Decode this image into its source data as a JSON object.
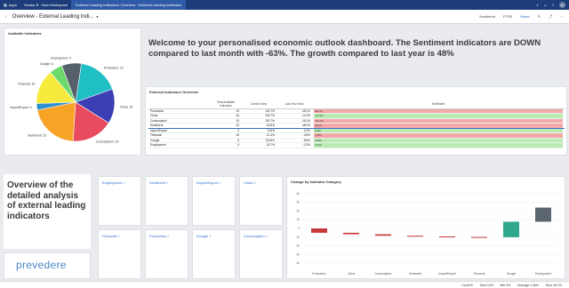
{
  "topbar": {
    "apps": "Apps",
    "workspace": "Vendor B · New Workspace",
    "tab": "External Leading Indicators: Overview · External Leading Indicators",
    "avatar": "ZH"
  },
  "sheet": {
    "title": "Overview - External Leading Indi...",
    "controls": [
      "Sentiment",
      "FTSE",
      "Reset"
    ]
  },
  "welcome": "Welcome to your personalised economic outlook dashboard. The Sentiment indicators are DOWN compared to last month with -63%. The growth compared to last year is 48%",
  "pie_panel": {
    "title": "Available Indicators"
  },
  "table_panel": {
    "title": "External Indicators Overview"
  },
  "table": {
    "headers": [
      "",
      "Total Available Indicators",
      "Current View",
      "Last Year View",
      "Sentiment"
    ],
    "rows": [
      {
        "name": "Production",
        "total": "19",
        "current": "100.7%",
        "last": "48.1%",
        "trend": "down"
      },
      {
        "name": "China",
        "total": "16",
        "current": "100.7%",
        "last": "-10.3%",
        "trend": "up"
      },
      {
        "name": "Consumption",
        "total": "19",
        "current": "100.7%",
        "last": "-16.1%",
        "trend": "down"
      },
      {
        "name": "Sentiment",
        "total": "23",
        "current": "-63.8%",
        "last": "48.0%",
        "trend": "down"
      },
      {
        "name": "Import/Export",
        "total": "3",
        "current": "74.8%",
        "last": "0.4%",
        "trend": "up"
      },
      {
        "name": "Financial",
        "total": "16",
        "current": "-21.3%",
        "last": "-3.8%",
        "trend": "down"
      },
      {
        "name": "Google",
        "total": "6",
        "current": "133.8%",
        "last": "-8.8%",
        "trend": "up"
      },
      {
        "name": "Employment",
        "total": "9",
        "current": "-32.7%",
        "last": "-0.3%",
        "trend": "up"
      }
    ]
  },
  "overview_text": "Overview of the detailed analysis of external leading indicators",
  "logo_text": "prevedere",
  "tiles": [
    {
      "label": "Employment >"
    },
    {
      "label": "Sentiment >"
    },
    {
      "label": "Import/Export >"
    },
    {
      "label": "China >"
    },
    {
      "label": "Financial >"
    },
    {
      "label": "Production >"
    },
    {
      "label": "Google >"
    },
    {
      "label": "Consumption >"
    }
  ],
  "waterfall_panel": {
    "title": "Change by Indicator Category"
  },
  "status": {
    "count": "Count 8",
    "sum": "Sum 4.53",
    "min": "Min 0%",
    "avg": "Average 1.4k%",
    "max": "Sum 40.1%"
  },
  "chart_data": [
    {
      "type": "pie",
      "title": "Available Indicators",
      "categories": [
        "Production",
        "China",
        "Consumption",
        "Sentiment",
        "Import/Export",
        "Financial",
        "Google",
        "Employment"
      ],
      "values": [
        19,
        16,
        19,
        23,
        3,
        16,
        6,
        9
      ],
      "colors": [
        "#1fbfc4",
        "#3c3fb3",
        "#e84a5f",
        "#f7a325",
        "#2d8ecf",
        "#f6eb3d",
        "#6cd96c",
        "#56606b"
      ]
    },
    {
      "type": "bar",
      "title": "Change by Indicator Category",
      "categories": [
        "Production",
        "China",
        "Consumption",
        "Sentiment",
        "Import/Export",
        "Financial",
        "Google",
        "Employment"
      ],
      "series": [
        {
          "values": [
            -5.0,
            -1.7,
            -1.7,
            -0.8,
            -0.6,
            -0.3,
            17.8,
            16.3
          ]
        }
      ],
      "starts": [
        0,
        -5.0,
        -6.7,
        -8.4,
        -9.2,
        -9.8,
        -10.1,
        7.7
      ],
      "yticks": [
        40,
        30,
        20,
        10,
        0,
        -10,
        -20,
        -30,
        -40
      ],
      "ylim": [
        -45,
        45
      ],
      "colors": {
        "down": "#c83a3a",
        "up": "#2fa88e",
        "total": "#5b6670"
      }
    }
  ]
}
